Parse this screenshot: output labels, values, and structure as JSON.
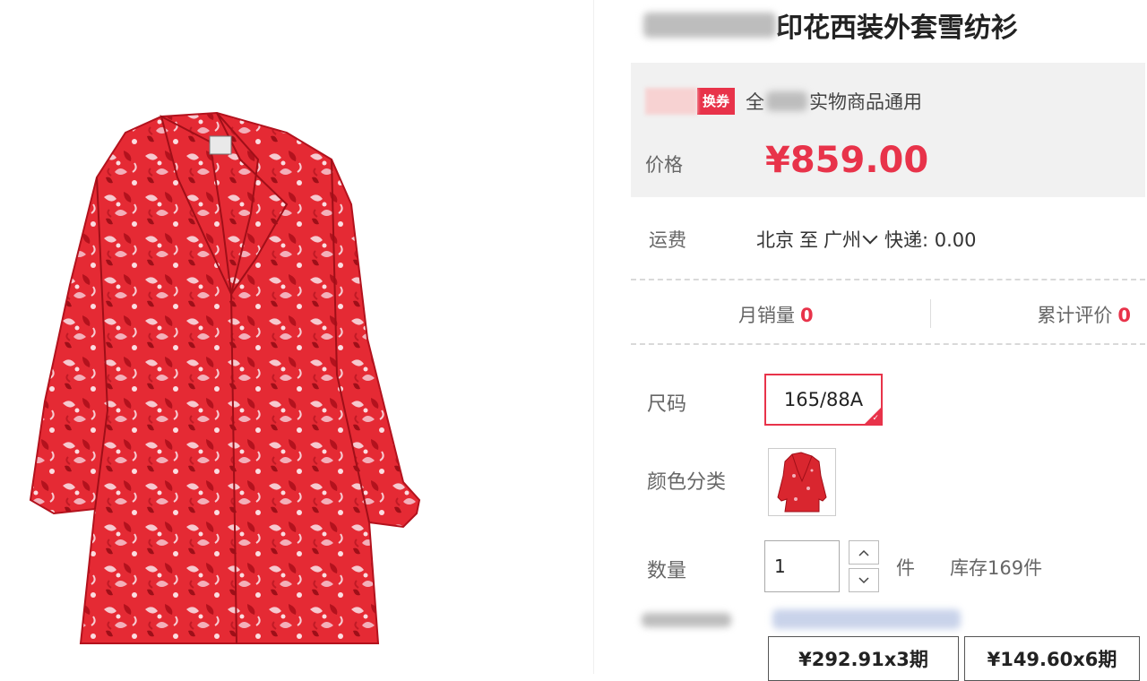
{
  "product": {
    "title_suffix": "印花西装外套雪纺衫"
  },
  "price_box": {
    "coupon_tag": "换券",
    "coupon_text_prefix": "全",
    "coupon_text_suffix": "实物商品通用",
    "price_label": "价格",
    "price_value": "¥859.00"
  },
  "shipping": {
    "label": "运费",
    "from": "北京",
    "to_word": "至",
    "destination": "广州",
    "method": "快递: 0.00"
  },
  "stats": {
    "monthly_sales_label": "月销量",
    "monthly_sales_value": "0",
    "reviews_label": "累计评价",
    "reviews_value": "0"
  },
  "options": {
    "size_label": "尺码",
    "size_selected": "165/88A",
    "color_label": "颜色分类",
    "quantity_label": "数量",
    "quantity_value": "1",
    "quantity_unit": "件",
    "stock_text": "库存169件"
  },
  "installments": [
    {
      "label": "¥292.91x3期"
    },
    {
      "label": "¥149.60x6期"
    }
  ],
  "colors": {
    "accent": "#e8334a",
    "price_box_bg": "#f1f1f1",
    "garment_red": "#d9262f"
  }
}
